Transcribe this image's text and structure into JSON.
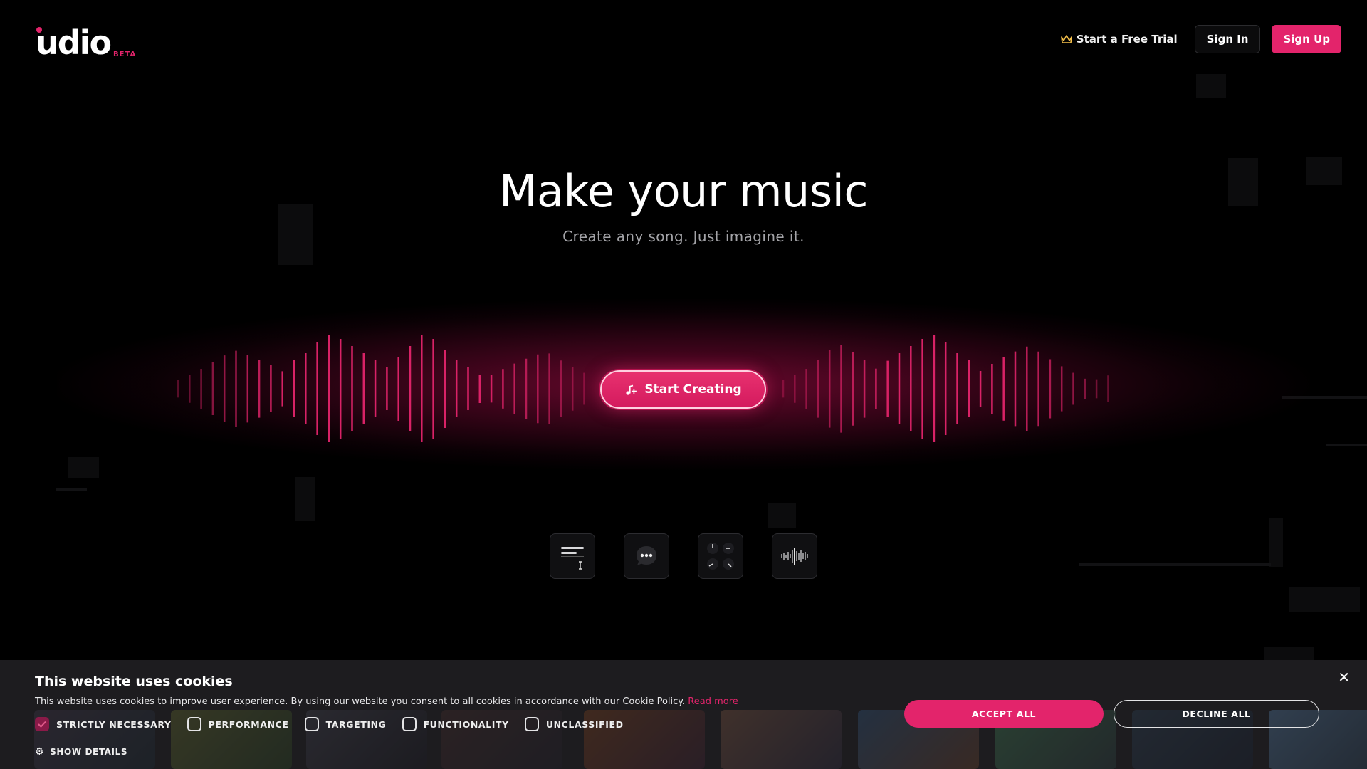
{
  "header": {
    "logo_text": "udio",
    "logo_badge": "BETA",
    "nav": {
      "trial_label": "Start a Free Trial",
      "trial_icon": "crown-icon",
      "signin_label": "Sign In",
      "signup_label": "Sign Up"
    }
  },
  "hero": {
    "title": "Make your music",
    "subtitle": "Create any song. Just imagine it.",
    "cta_label": "Start Creating",
    "cta_icon": "music-note-plus-icon"
  },
  "tools": [
    {
      "name": "lyrics-editor-tool",
      "icon": "text-lines-icon"
    },
    {
      "name": "prompt-chat-tool",
      "icon": "chat-bubble-icon"
    },
    {
      "name": "knobs-controls-tool",
      "icon": "knobs-icon"
    },
    {
      "name": "audio-waveform-tool",
      "icon": "waveform-icon"
    }
  ],
  "cookie": {
    "title": "This website uses cookies",
    "description": "This website uses cookies to improve user experience. By using our website you consent to all cookies in accordance with our Cookie Policy.",
    "read_more": "Read more",
    "options": [
      {
        "label": "STRICTLY NECESSARY",
        "checked": true
      },
      {
        "label": "PERFORMANCE",
        "checked": false
      },
      {
        "label": "TARGETING",
        "checked": false
      },
      {
        "label": "FUNCTIONALITY",
        "checked": false
      },
      {
        "label": "UNCLASSIFIED",
        "checked": false
      }
    ],
    "show_details": "SHOW DETAILS",
    "accept_label": "ACCEPT ALL",
    "decline_label": "DECLINE ALL",
    "close_icon": "close-icon"
  },
  "colors": {
    "accent": "#e3246b",
    "background": "#000000",
    "banner": "#1d1c1f"
  }
}
